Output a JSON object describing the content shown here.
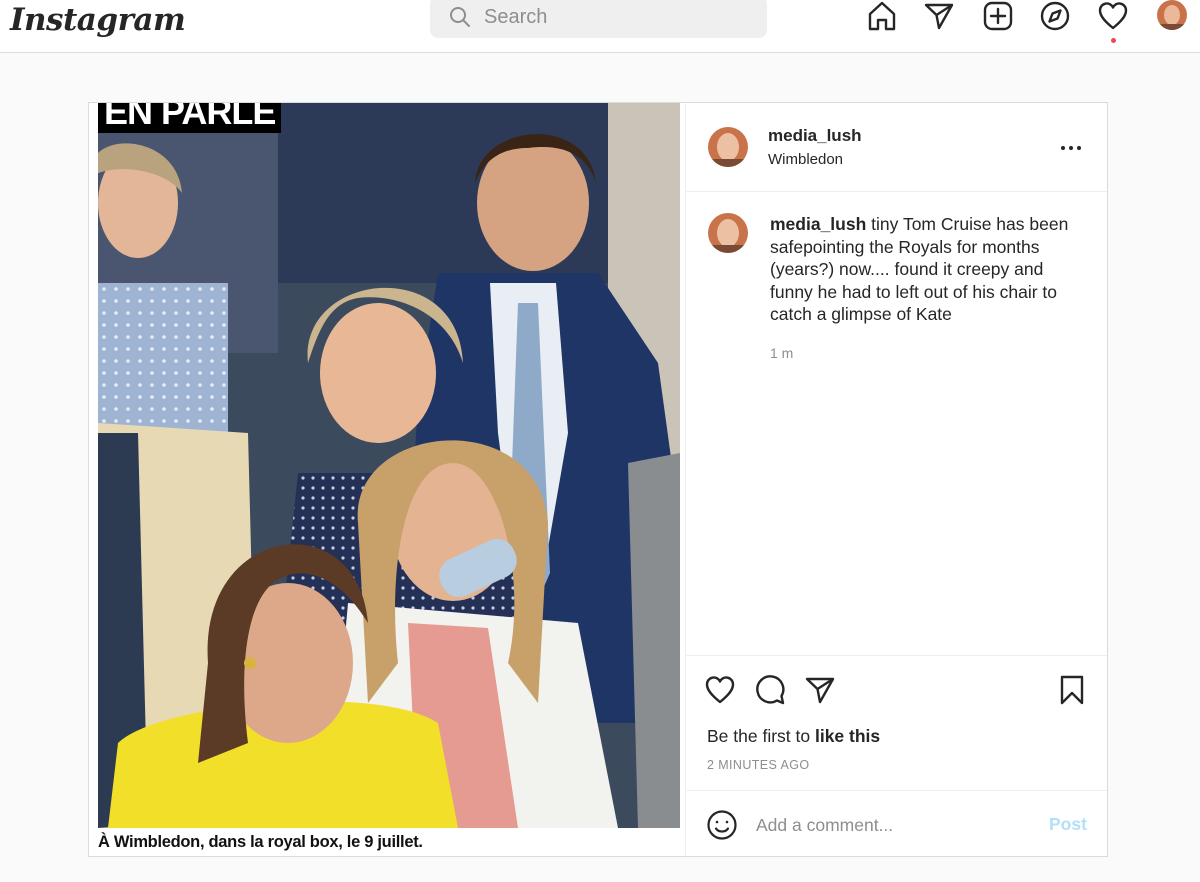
{
  "nav": {
    "logo": "Instagram",
    "search_placeholder": "Search",
    "icons": [
      "home-icon",
      "direct-message-icon",
      "new-post-icon",
      "explore-icon",
      "activity-heart-icon",
      "profile-avatar"
    ]
  },
  "post": {
    "header": {
      "username": "media_lush",
      "location": "Wimbledon"
    },
    "photo": {
      "banner_text": "EN PARLE",
      "caption": "À Wimbledon, dans la royal box, le 9 juillet."
    },
    "comment": {
      "username": "media_lush",
      "text": "tiny Tom Cruise has been safepointing the Royals for months (years?) now.... found it creepy and funny he had to left out of his chair to catch a glimpse of Kate",
      "time": "1 m"
    },
    "likes": {
      "prefix": "Be the first to ",
      "action": "like this"
    },
    "timestamp": "2 MINUTES AGO",
    "add_comment": {
      "placeholder": "Add a comment...",
      "post_label": "Post"
    }
  },
  "colors": {
    "notification_dot": "#ed4956",
    "post_button_disabled": "#b2dffc",
    "secondary_text": "#8e8e8e"
  }
}
